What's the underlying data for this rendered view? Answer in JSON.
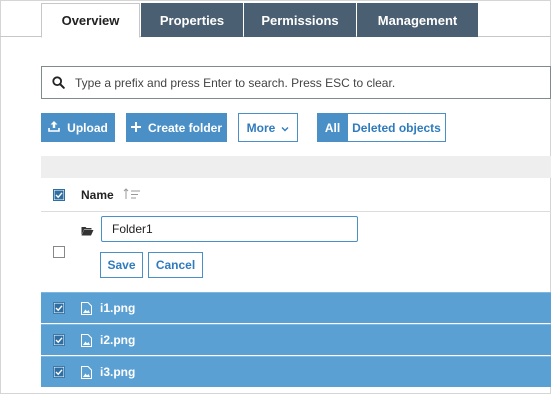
{
  "tabs": [
    {
      "label": "Overview"
    },
    {
      "label": "Properties"
    },
    {
      "label": "Permissions"
    },
    {
      "label": "Management"
    }
  ],
  "search": {
    "placeholder": "Type a prefix and press Enter to search. Press ESC to clear."
  },
  "actions": {
    "upload": "Upload",
    "create_folder": "Create folder",
    "more": "More",
    "all": "All",
    "deleted_objects": "Deleted objects"
  },
  "table": {
    "name_header": "Name",
    "new_folder": {
      "value": "Folder1",
      "save": "Save",
      "cancel": "Cancel"
    },
    "files": [
      {
        "name": "i1.png"
      },
      {
        "name": "i2.png"
      },
      {
        "name": "i3.png"
      }
    ]
  },
  "colors": {
    "tab_dark": "#4b5f72",
    "accent": "#4a90c7",
    "selected_row": "#5aa0d2"
  }
}
